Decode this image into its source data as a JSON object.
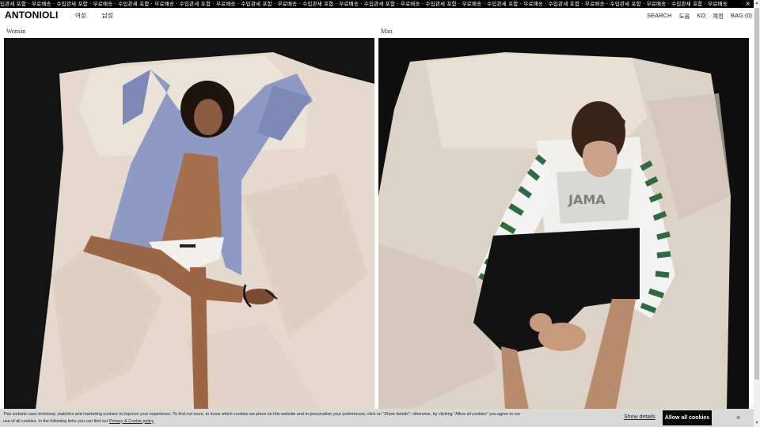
{
  "announcement": {
    "text": "입관세 포함 · 무료배송 · 수입관세 포함 · 무료배송 · 수입관세 포함 · 무료배송 · 수입관세 포함 · 무료배송 · 수입관세 포함 · 무료배송 · 수입관세 포함 · 무료배송 · 수입관세 포함 · 무료배송 · 수입관세 포함 · 무료배송 · 수입관세 포함 · 무료배송 · 수입관세 포함 · 무료배송 · 수입관세 포함 · 무료배송 · 수입관세 포함 · 무료배송",
    "close": "×"
  },
  "header": {
    "logo": "ANTONIOLI",
    "nav_left": [
      "여성",
      "남성"
    ],
    "nav_right": [
      "SEARCH",
      "도움",
      "KO",
      "계정",
      "BAG (0)"
    ]
  },
  "sections": {
    "woman_label": "Woman",
    "man_label": "Man"
  },
  "cookie": {
    "text_line1": "This website uses technical, statistics and marketing cookies to improve your experience. To find out more, to know which cookies we place on this website and to personalize your preferences, click on \"Show details\"; otherwise, by clicking \"Allow all cookies\" you agree to our",
    "text_line2": "use of all cookies. In the following links you can find our",
    "policy_link": "Privacy & Cookie policy",
    "show_details": "Show details",
    "allow_all": "Allow all cookies",
    "close": "×"
  },
  "colors": {
    "brand_black": "#000000",
    "cookie_bg": "#d9d9d9",
    "sheet": "#e8ded2",
    "shirt_blue": "#8f9ac4",
    "stripe_green": "#2f6b3f"
  }
}
